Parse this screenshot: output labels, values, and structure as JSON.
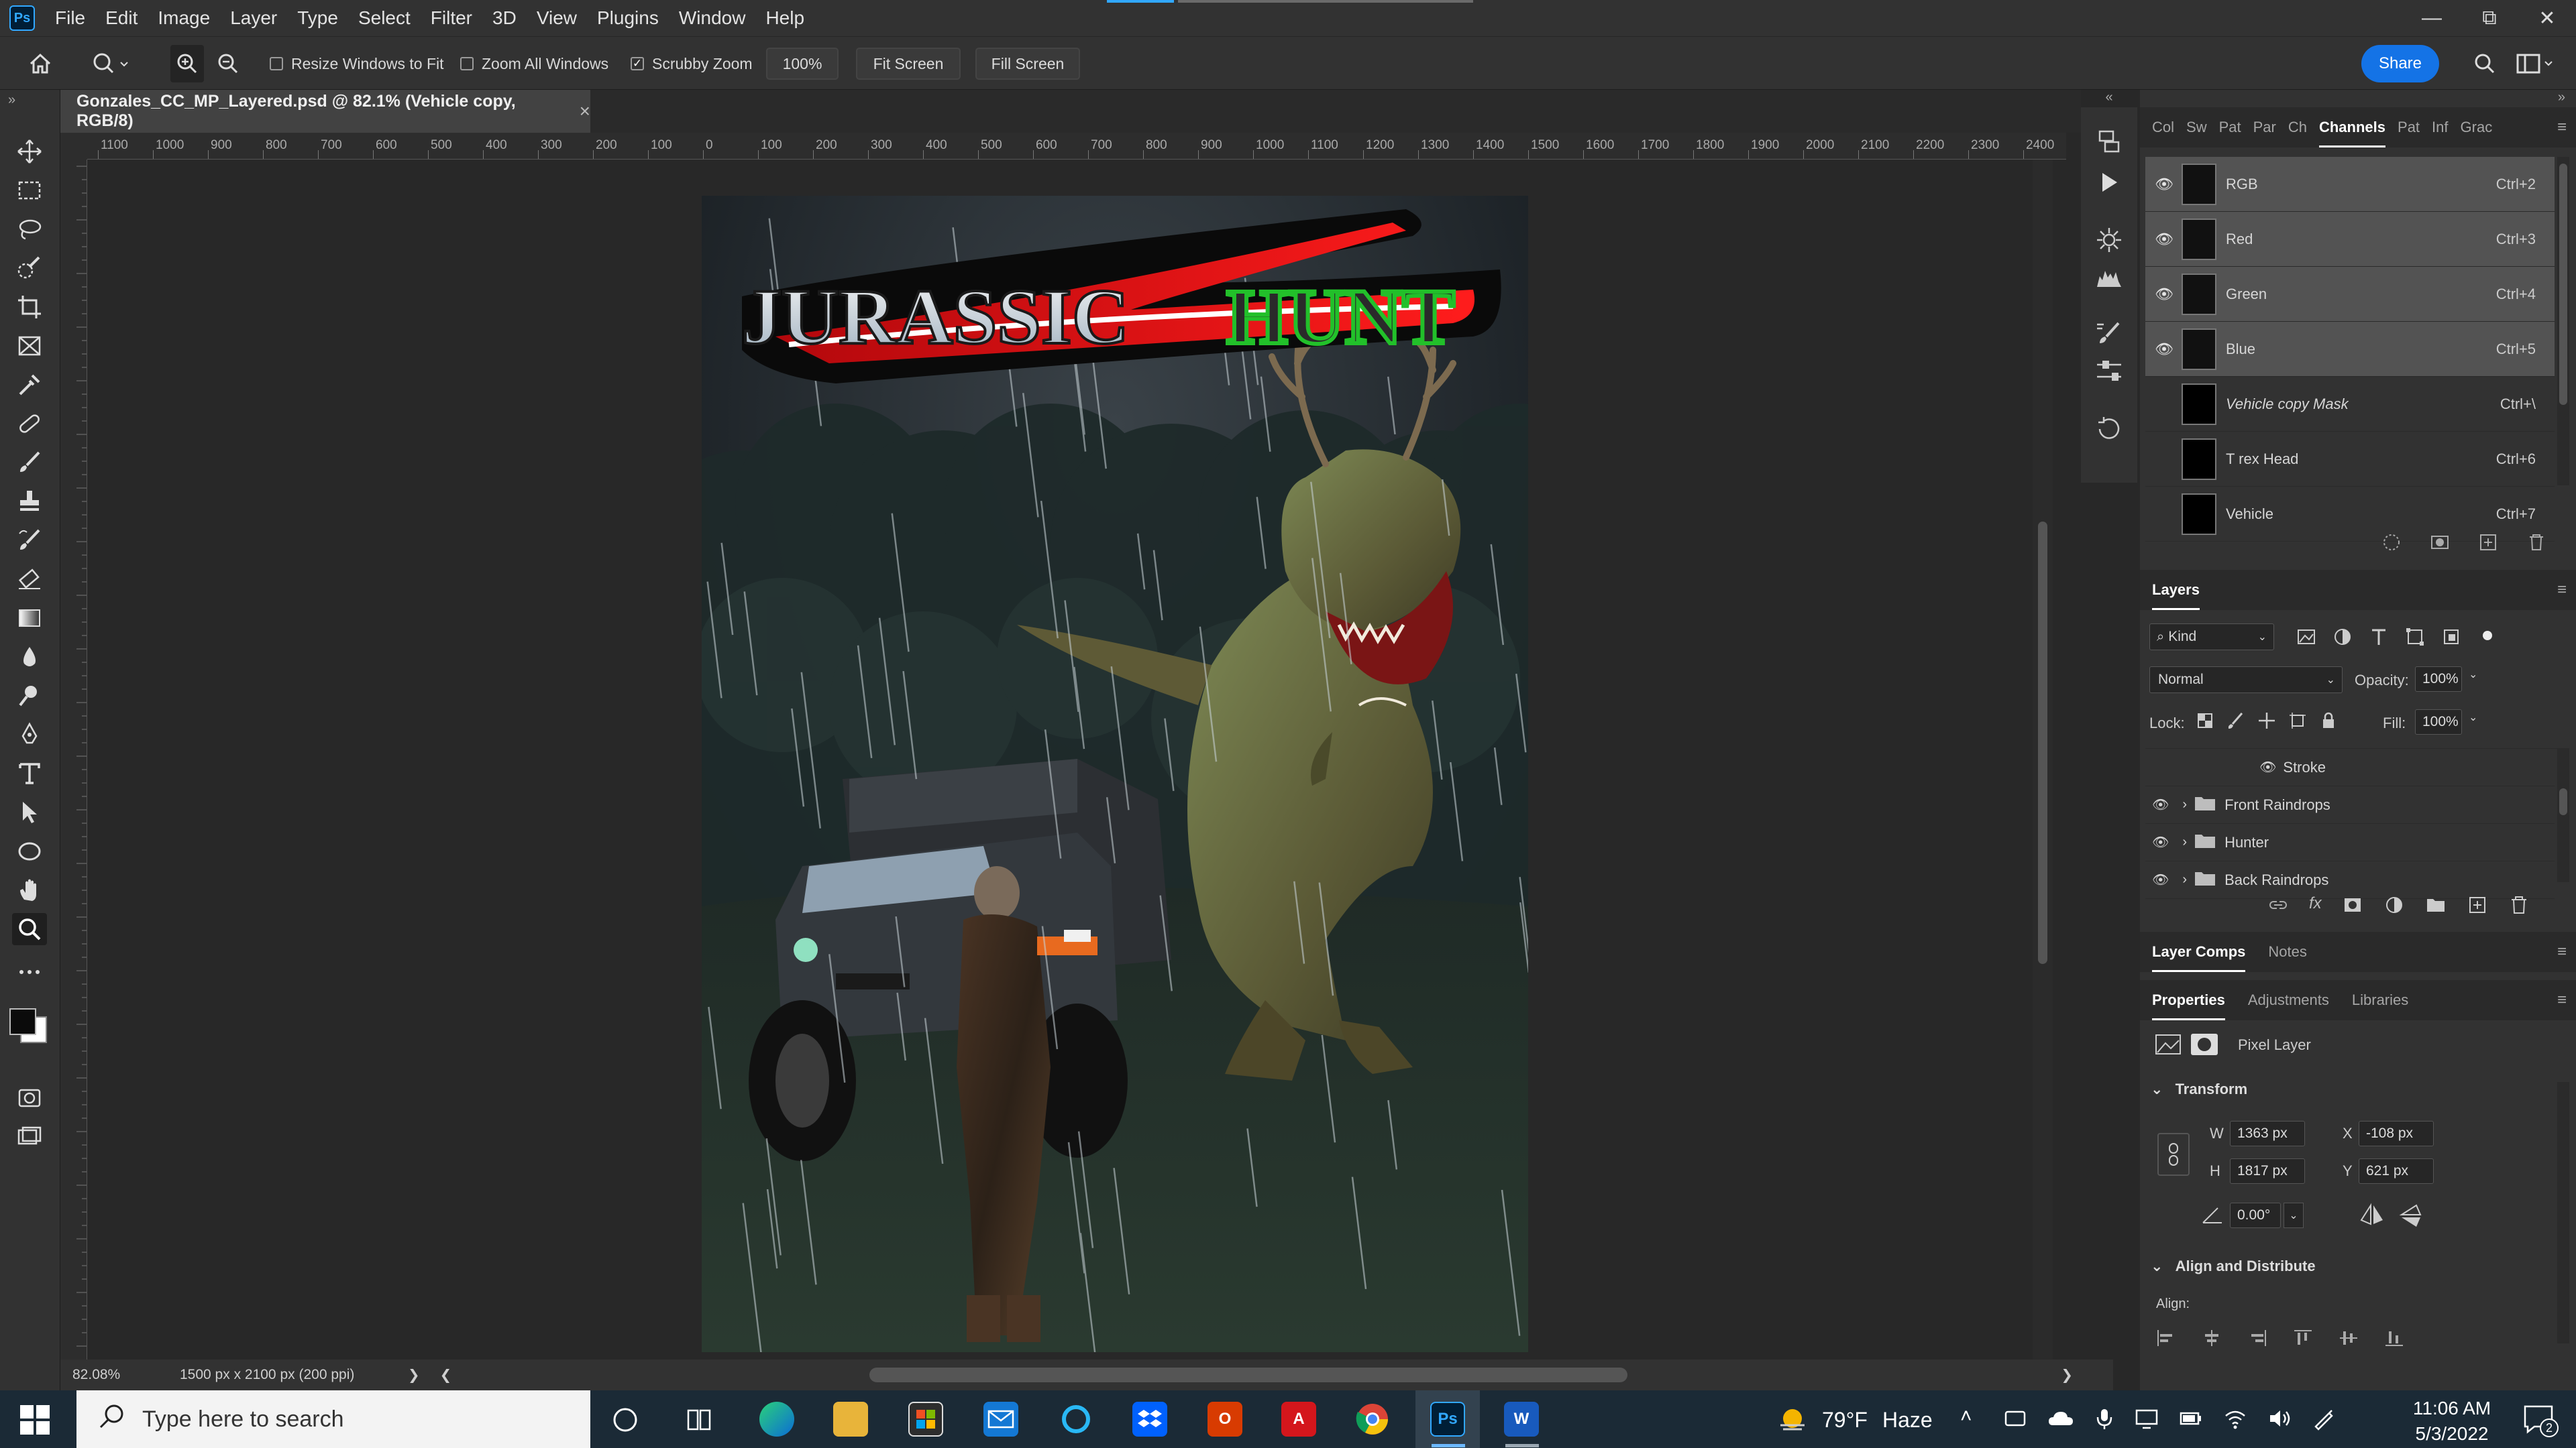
{
  "menubar": {
    "logo": "Ps",
    "items": [
      "File",
      "Edit",
      "Image",
      "Layer",
      "Type",
      "Select",
      "Filter",
      "3D",
      "View",
      "Plugins",
      "Window",
      "Help"
    ],
    "window_controls": [
      "—",
      "⧉",
      "✕"
    ]
  },
  "options": {
    "resize_windows": "Resize Windows to Fit",
    "zoom_all": "Zoom All Windows",
    "scrubby_zoom": "Scrubby Zoom",
    "zoom_value": "100%",
    "fit_screen": "Fit Screen",
    "fill_screen": "Fill Screen",
    "share": "Share"
  },
  "document": {
    "tab_title": "Gonzales_CC_MP_Layered.psd @ 82.1% (Vehicle copy, RGB/8)",
    "close": "×"
  },
  "ruler": {
    "horizontal": [
      "1100",
      "1000",
      "900",
      "800",
      "700",
      "600",
      "500",
      "400",
      "300",
      "200",
      "100",
      "0",
      "100",
      "200",
      "300",
      "400",
      "500",
      "600",
      "700",
      "800",
      "900",
      "1000",
      "1100",
      "1200",
      "1300",
      "1400",
      "1500",
      "1600",
      "1700",
      "1800",
      "1900",
      "2000",
      "2100",
      "2200",
      "2300",
      "2400"
    ]
  },
  "artwork": {
    "title_word1": "JURASSIC",
    "title_word2": "HUNT"
  },
  "status": {
    "zoom": "82.08%",
    "doc_size": "1500 px x 2100 px (200 ppi)",
    "arrow": "❯",
    "scroll_left": "❮",
    "scroll_right": "❯"
  },
  "channels_panel": {
    "tabs": [
      "Col",
      "Sw",
      "Pat",
      "Par",
      "Ch",
      "Channels",
      "Pat",
      "Inf",
      "Grac"
    ],
    "active_tab": "Channels",
    "rows": [
      {
        "name": "RGB",
        "shortcut": "Ctrl+2",
        "visible": true
      },
      {
        "name": "Red",
        "shortcut": "Ctrl+3",
        "visible": true
      },
      {
        "name": "Green",
        "shortcut": "Ctrl+4",
        "visible": true
      },
      {
        "name": "Blue",
        "shortcut": "Ctrl+5",
        "visible": true
      },
      {
        "name": "Vehicle copy Mask",
        "shortcut": "Ctrl+\\",
        "visible": false
      },
      {
        "name": "T rex Head",
        "shortcut": "Ctrl+6",
        "visible": false
      },
      {
        "name": "Vehicle",
        "shortcut": "Ctrl+7",
        "visible": false
      }
    ]
  },
  "layers_panel": {
    "title": "Layers",
    "kind": "Kind",
    "blend_mode": "Normal",
    "opacity_label": "Opacity:",
    "opacity": "100%",
    "lock_label": "Lock:",
    "fill_label": "Fill:",
    "fill": "100%",
    "rows": [
      {
        "name": "Stroke",
        "type": "effect"
      },
      {
        "name": "Front Raindrops",
        "type": "group"
      },
      {
        "name": "Hunter",
        "type": "group"
      },
      {
        "name": "Back Raindrops",
        "type": "group"
      }
    ]
  },
  "comps_tabs": [
    "Layer Comps",
    "Notes"
  ],
  "properties_tabs": [
    "Properties",
    "Adjustments",
    "Libraries"
  ],
  "properties": {
    "layer_type": "Pixel Layer",
    "transform_title": "Transform",
    "w_label": "W",
    "w": "1363 px",
    "x_label": "X",
    "x": "-108 px",
    "h_label": "H",
    "h": "1817 px",
    "y_label": "Y",
    "y": "621 px",
    "angle": "0.00°",
    "align_title": "Align and Distribute",
    "align_label": "Align:"
  },
  "taskbar": {
    "search_placeholder": "Type here to search",
    "weather_temp": "79°F",
    "weather_desc": "Haze",
    "time": "11:06 AM",
    "date": "5/3/2022",
    "notification_count": "2",
    "apps": [
      "Ps",
      "W"
    ]
  }
}
